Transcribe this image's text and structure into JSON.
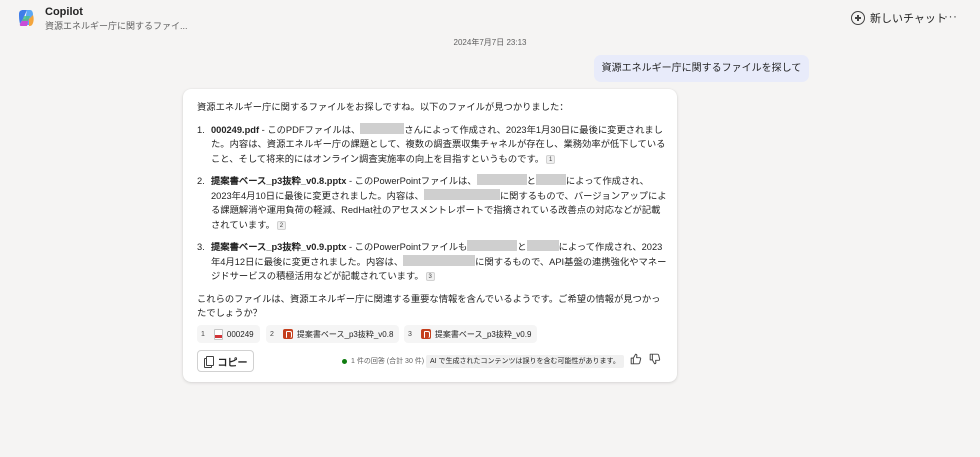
{
  "header": {
    "app_title": "Copilot",
    "conversation_title": "資源エネルギー庁に関するファイ...",
    "new_chat_label": "新しいチャット",
    "more_label": "···"
  },
  "timestamp": "2024年7月7日 23:13",
  "user_message": "資源エネルギー庁に関するファイルを探して",
  "response": {
    "intro": "資源エネルギー庁に関するファイルをお探しですね。以下のファイルが見つかりました：",
    "items": [
      {
        "num": "1.",
        "name": "000249.pdf",
        "t1": " - このPDFファイルは、",
        "t2": "さんによって作成され、2023年1月30日に最後に変更されました。内容は、資源エネルギー庁の課題として、複数の調査票収集チャネルが存在し、業務効率が低下していること、そして将来的にはオンライン調査実施率の向上を目指すというものです。",
        "ref": "1"
      },
      {
        "num": "2.",
        "name": "提案書ベース_p3抜粋_v0.8.pptx",
        "t1": " - このPowerPointファイルは、",
        "t2": "と",
        "t3": "によって作成され、2023年4月10日に最後に変更されました。内容は、",
        "t4": "に関するもので、バージョンアップによる課題解消や運用負荷の軽減、RedHat社のアセスメントレポートで指摘されている改善点の対応などが記載されています。",
        "ref": "2"
      },
      {
        "num": "3.",
        "name": "提案書ベース_p3抜粋_v0.9.pptx",
        "t1": " - このPowerPointファイルも",
        "t2": "と",
        "t3": "によって作成され、2023年4月12日に最後に変更されました。内容は、",
        "t4": "に関するもので、API基盤の連携強化やマネージドサービスの積極活用などが記載されています。",
        "ref": "3"
      }
    ],
    "outro": "これらのファイルは、資源エネルギー庁に関連する重要な情報を含んでいるようです。ご希望の情報が見つかったでしょうか？"
  },
  "references": [
    {
      "num": "1",
      "label": "000249",
      "icon": "pdf-icon"
    },
    {
      "num": "2",
      "label": "提案書ベース_p3抜粋_v0.8",
      "icon": "pptx-icon"
    },
    {
      "num": "3",
      "label": "提案書ベース_p3抜粋_v0.9",
      "icon": "pptx-icon"
    }
  ],
  "footer": {
    "copy_label": "コピー",
    "responses_label": "1 件の回答 (合計 30 件)",
    "disclaimer": "AI で生成されたコンテンツは誤りを含む可能性があります。"
  },
  "colors": {
    "background": "#f5f4f3",
    "user_bubble": "#e8ebfa",
    "card": "#ffffff",
    "status_dot": "#107c10",
    "pdf_red": "#d13438",
    "ppt_orange": "#c43e1c"
  }
}
